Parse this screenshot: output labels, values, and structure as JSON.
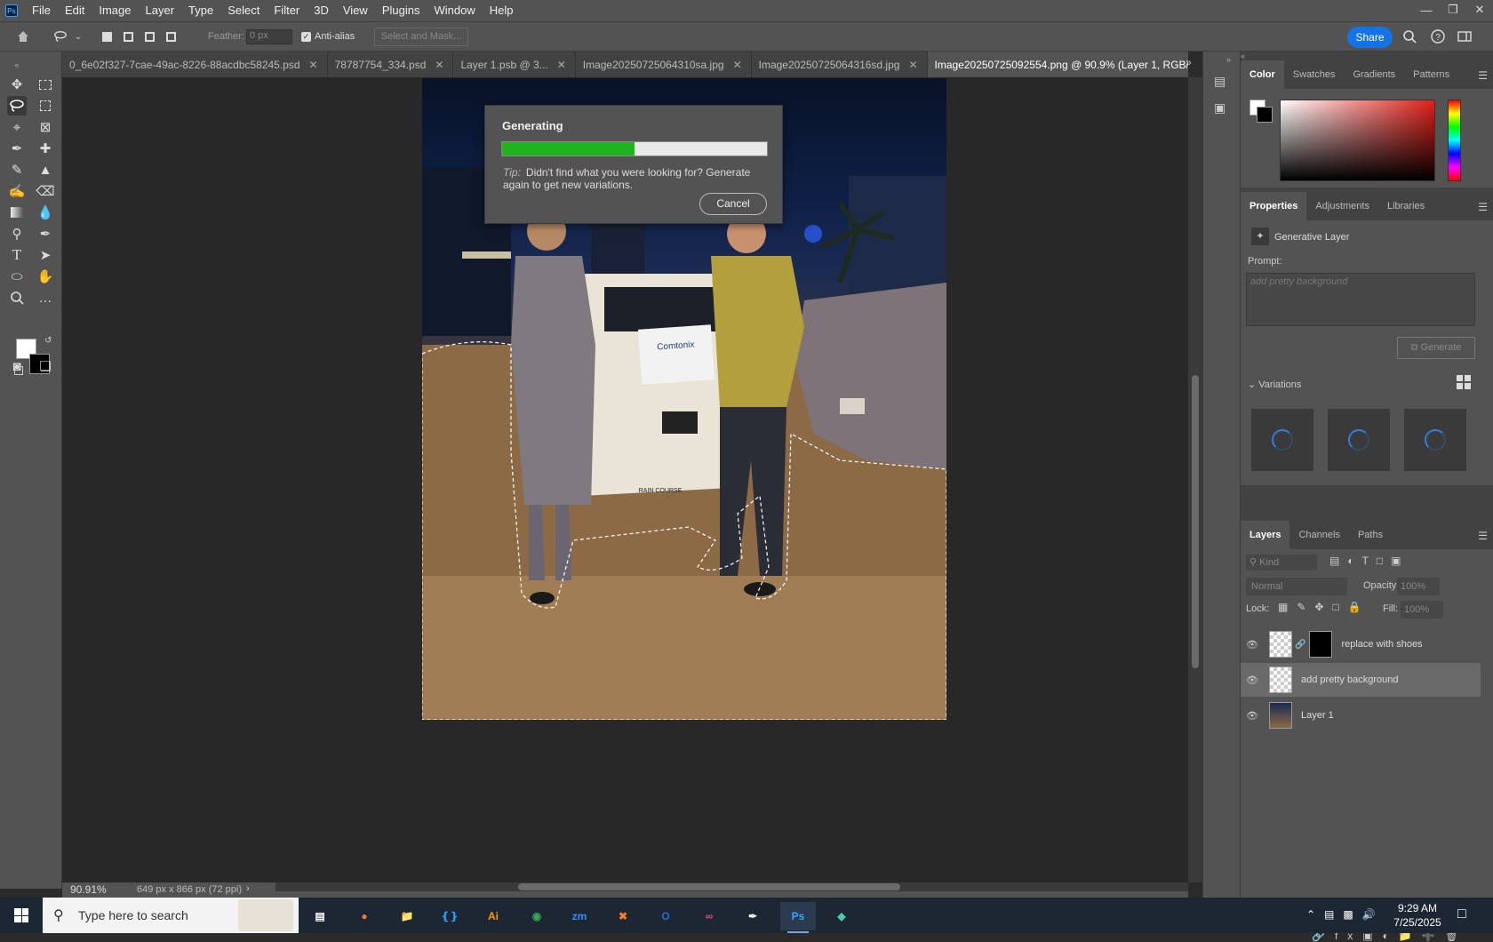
{
  "menubar": {
    "logo": "Ps",
    "items": [
      "File",
      "Edit",
      "Image",
      "Layer",
      "Type",
      "Select",
      "Filter",
      "3D",
      "View",
      "Plugins",
      "Window",
      "Help"
    ]
  },
  "options_bar": {
    "feather_label": "Feather:",
    "feather_value": "0 px",
    "antialias_label": "Anti-alias",
    "select_mask_label": "Select and Mask...",
    "share_label": "Share"
  },
  "tabs": [
    {
      "label": "0_6e02f327-7cae-49ac-8226-88acdbc58245.psd",
      "active": false
    },
    {
      "label": "78787754_334.psd",
      "active": false
    },
    {
      "label": "Layer 1.psb @ 3...",
      "active": false
    },
    {
      "label": "Image20250725064310sa.jpg",
      "active": false
    },
    {
      "label": "Image20250725064316sd.jpg",
      "active": false
    },
    {
      "label": "Image20250725092554.png @ 90.9% (Layer 1, RGB/8#) *",
      "active": true
    }
  ],
  "generating_dialog": {
    "title": "Generating",
    "progress": 0.5,
    "tip_label": "Tip:",
    "tip_text": "Didn't find what you were looking for? Generate again to get new variations.",
    "cancel_label": "Cancel"
  },
  "canvas_content": {
    "sign_text": "Comtonix",
    "plate_text": "RAIN COURSE"
  },
  "statusbar": {
    "zoom": "90.91%",
    "doc_size": "649 px x 866 px (72 ppi)"
  },
  "color_panel": {
    "tabs": [
      "Color",
      "Swatches",
      "Gradients",
      "Patterns"
    ],
    "foreground": "#ffffff",
    "background": "#000000",
    "hue_color": "#e0201a"
  },
  "properties_panel": {
    "tabs": [
      "Properties",
      "Adjustments",
      "Libraries"
    ],
    "layer_type": "Generative Layer",
    "prompt_label": "Prompt:",
    "prompt_placeholder": "add pretty background",
    "generate_label": "Generate",
    "variations_label": "Variations"
  },
  "layers_panel": {
    "tabs": [
      "Layers",
      "Channels",
      "Paths"
    ],
    "kind_placeholder": "Kind",
    "blend_mode": "Normal",
    "opacity_label": "Opacity:",
    "opacity_value": "100%",
    "lock_label": "Lock:",
    "fill_label": "Fill:",
    "fill_value": "100%",
    "layers": [
      {
        "name": "replace with shoes",
        "selected": false
      },
      {
        "name": "add pretty background",
        "selected": true
      },
      {
        "name": "Layer 1",
        "selected": false
      }
    ]
  },
  "taskbar": {
    "search_placeholder": "Type here to search",
    "time": "9:29 AM",
    "date": "7/25/2025",
    "apps": [
      "firefox-icon",
      "file-explorer-icon",
      "vscode-icon",
      "illustrator-icon",
      "chrome-icon",
      "zoom-icon",
      "xampp-icon",
      "outlook-icon",
      "creative-cloud-icon",
      "pen-tool-app-icon",
      "photoshop-icon",
      "diamond-app-icon"
    ]
  },
  "colors": {
    "accent": "#1473e6",
    "progress": "#1fb31f",
    "spinner": "#2f7fe0"
  }
}
